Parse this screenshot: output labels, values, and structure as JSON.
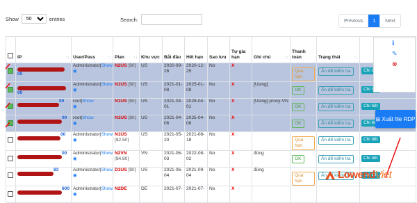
{
  "controls": {
    "show_label": "Show",
    "entries_value": "50",
    "entries_label": "entries",
    "search_label": "Search:",
    "search_value": ""
  },
  "pagination": {
    "previous": "Previous",
    "current": "1",
    "next": "Next"
  },
  "columns": [
    "",
    "IP",
    "User/Pass",
    "Plan",
    "Khu vực",
    "Bắt đầu",
    "Hết hạn",
    "Sao lưu",
    "Tự gia hạn",
    "Ghi chú",
    "Thanh toán",
    "Trạng thái",
    ""
  ],
  "rows": [
    {
      "ip_suffix": "00",
      "user": "Administrator|Show",
      "plan": "N2US",
      "price": "[$0]",
      "region": "US",
      "start": "2020-09-26",
      "end": "2020-12-25",
      "backup": "No",
      "renew": "X",
      "note": "",
      "pay": "Quá hạn",
      "status": "Ẩn để kiểm tra",
      "action": "Chi tiết"
    },
    {
      "ip_suffix": "00",
      "user": "Administrator|Show",
      "plan": "N1US",
      "price": "[$0]",
      "region": "US",
      "start": "2021-01-08",
      "end": "2025-01-08",
      "backup": "No",
      "renew": "X",
      "note": "[Using]",
      "pay": "OK",
      "status": "Ẩn để kiểm tra",
      "action": "Chi tiết"
    },
    {
      "ip_suffix": "00",
      "user": "root|Show",
      "plan": "N1US",
      "price": "[$0]",
      "region": "US",
      "start": "2021-04-01",
      "end": "2028-04-01",
      "backup": "No",
      "renew": "X",
      "note": "[Using] proxy-VN",
      "pay": "OK",
      "status": "Ẩn để kiểm tra",
      "action": "Chi tiết"
    },
    {
      "ip_suffix": "00",
      "user": "root|Show",
      "plan": "N1US",
      "price": "[$0]",
      "region": "US",
      "start": "2021-04-06",
      "end": "2025-04-06",
      "backup": "No",
      "renew": "X",
      "note": "",
      "pay": "OK",
      "status": "Ẩn để kiểm tra",
      "action": "Chi tiết"
    },
    {
      "ip_suffix": "00",
      "user": "Administrator|Show",
      "plan": "N1US",
      "price": "[$2.50]",
      "region": "US",
      "start": "2021-05-20",
      "end": "2021-08-18",
      "backup": "No",
      "renew": "X",
      "note": "",
      "pay": "Quá hạn",
      "status": "Ẩn để kiểm tra",
      "action": "Chi tiết"
    },
    {
      "ip_suffix": "00",
      "user": "Administrator|Show",
      "plan": "N2VN",
      "price": "[$4.80]",
      "region": "VN",
      "start": "2021-06-03",
      "end": "2022-08-02",
      "backup": "No",
      "renew": "X",
      "note": "đùng",
      "pay": "OK",
      "status": "Ẩn để kiểm tra",
      "action": "Chi tiết"
    },
    {
      "ip_suffix": "83",
      "user": "Administrator|Show",
      "plan": "D1US",
      "price": "[$0]",
      "region": "US",
      "start": "2021-06-04",
      "end": "2021-09-04",
      "backup": "No",
      "renew": "X",
      "note": "đùng",
      "pay": "Quá hạn",
      "status": "Ẩn để kiểm tra",
      "action": "Chi tiết"
    },
    {
      "ip_suffix": "600",
      "user": "Administrator|Show",
      "plan": "N2DE",
      "price": "",
      "region": "DE",
      "start": "2021-07-",
      "end": "2021-07-",
      "backup": "No",
      "renew": "X",
      "note": "",
      "pay": "",
      "status": "",
      "action": ""
    }
  ],
  "selected_rows": [
    0,
    1,
    2,
    3
  ],
  "export_button": "Xuất file RDP",
  "brand": {
    "part1": "Lowend",
    "part2": "Viet"
  },
  "colors": {
    "accent": "#1a7cf5",
    "selected_row": "#b9c4de",
    "plan_red": "#d40000",
    "ok_green": "#5cb85c",
    "warn_orange": "#f0ad4e",
    "info_teal": "#17a2b8"
  }
}
